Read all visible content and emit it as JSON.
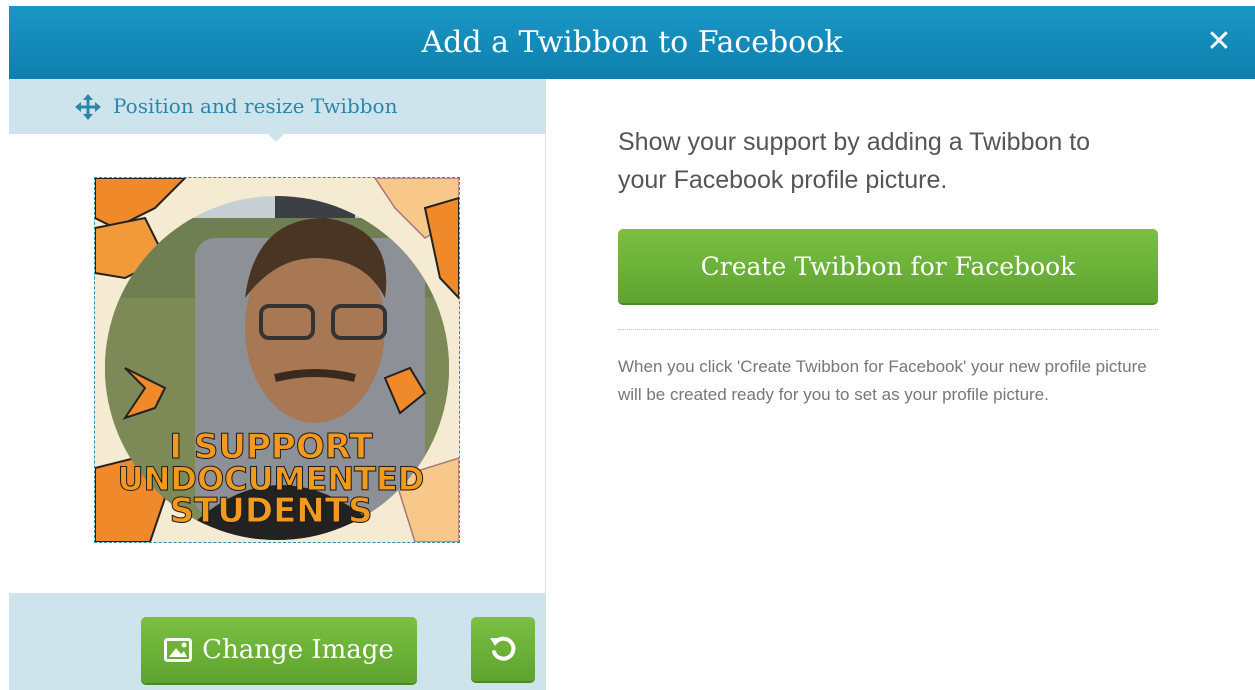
{
  "header": {
    "title": "Add a Twibbon to Facebook",
    "close_icon": "close-icon"
  },
  "left": {
    "position_label": "Position and resize Twibbon",
    "position_icon": "move-arrows-icon",
    "banner_lines": [
      "I SUPPORT",
      "UNDOCUMENTED",
      "STUDENTS"
    ],
    "change_image_label": "Change Image",
    "change_image_icon": "image-icon",
    "reset_icon": "rotate-reset-icon"
  },
  "right": {
    "intro": "Show your support by adding a Twibbon to your Facebook profile picture.",
    "create_button_label": "Create Twibbon for Facebook",
    "note": "When you click 'Create Twibbon for Facebook' your new profile picture will be created ready for you to set as your profile picture."
  },
  "colors": {
    "header": "#1287b8",
    "accent_green": "#6db33f",
    "panel_blue": "#cde4ed",
    "banner_orange": "#f39a1e"
  }
}
